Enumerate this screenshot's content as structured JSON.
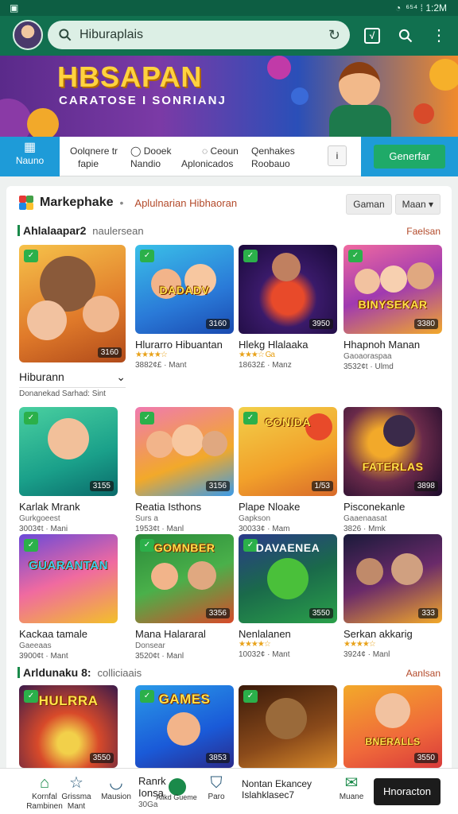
{
  "status": {
    "left_icon": "sim-icon",
    "right_text": "⁶⁵⁴ ⁞ 1:2M"
  },
  "appbar": {
    "search_placeholder": "Hiburaplais",
    "icons": [
      "avatar",
      "search-icon",
      "refresh-icon",
      "tv-icon",
      "search-icon",
      "more-vert-icon"
    ]
  },
  "banner": {
    "title": "HBSAPAN",
    "subtitle": "CARATOSE I SONRIANJ"
  },
  "tabs": {
    "active": "Nauno",
    "items": [
      {
        "label": "Oolqnere tr",
        "sub": "fapie"
      },
      {
        "label": "Dooek",
        "sub": "Nandio"
      },
      {
        "label": "Ceoun",
        "sub": "Aplonicados"
      },
      {
        "label": "Qenhakes",
        "sub": "Roobauo"
      }
    ],
    "mini": "i",
    "cta": "Generfar"
  },
  "market": {
    "name": "Markephake",
    "sub": "Aplulnarian Hibhaoran",
    "filters": [
      "Gaman",
      "Maan ▾"
    ]
  },
  "section1": {
    "title": "Ahlalaapar2",
    "desc": "naulersean",
    "more": "Faelsan",
    "featured": {
      "title": "Hiburann",
      "sub": "Donanekad Sarhad: Sint"
    },
    "row1": [
      {
        "title": "Hlurarro Hibuantan",
        "sub": "",
        "stars": "★★★★☆",
        "meta": "3882¢£ · Mant",
        "rate": "3160",
        "cap": "DADADV"
      },
      {
        "title": "Hlekg Hlalaaka",
        "sub": "",
        "stars": "★★★☆ Ga",
        "meta": "18632£ · Manz",
        "rate": "3950",
        "cap": ""
      },
      {
        "title": "Hhapnoh Manan",
        "sub": "Gaoaoraspaa",
        "stars": "",
        "meta": "3532¢t · Ulmd",
        "rate": "3380",
        "cap": "BINYSEKAR"
      }
    ],
    "row2": [
      {
        "title": "Karlak Mrank",
        "sub": "Gurkgoeest",
        "stars": "",
        "meta": "3003¢t · Mani",
        "rate": "3155",
        "cap": ""
      },
      {
        "title": "Reatia Isthons",
        "sub": "Surs a",
        "stars": "",
        "meta": "1953¢t · Manl",
        "rate": "3156",
        "cap": ""
      },
      {
        "title": "Plape Nloake",
        "sub": "Gapkson",
        "stars": "",
        "meta": "30033¢ · Mam",
        "rate": "1/53",
        "cap": "CONIDA"
      },
      {
        "title": "Pisconekanle",
        "sub": "Gaaenaasat",
        "stars": "",
        "meta": "3826 · Mmk",
        "rate": "3898",
        "cap": "FATERLAS"
      }
    ],
    "row3": [
      {
        "title": "Kackaa tamale",
        "sub": "Gaeeaas",
        "stars": "",
        "meta": "3900¢t · Mant",
        "rate": "",
        "cap": "GUARANTAN"
      },
      {
        "title": "Mana Halararal",
        "sub": "Donsear",
        "stars": "",
        "meta": "3520¢t · Manl",
        "rate": "3356",
        "cap": "GOMNBER"
      },
      {
        "title": "Nenlalanen",
        "sub": "",
        "stars": "★★★★☆",
        "meta": "10032¢ · Mant",
        "rate": "3550",
        "cap": "DAVAENEA"
      },
      {
        "title": "Serkan akkarig",
        "sub": "",
        "stars": "★★★★☆",
        "meta": "3924¢ · Manl",
        "rate": "333",
        "cap": ""
      }
    ]
  },
  "section2": {
    "title": "Arldunaku 8:",
    "desc": "colliciaais",
    "more": "Aanlsan",
    "row": [
      {
        "cap": "HULRRA",
        "rate": "3550"
      },
      {
        "cap": "GAMES",
        "rate": "3853"
      },
      {
        "cap": "",
        "rate": ""
      },
      {
        "cap": "BNERALLS",
        "rate": "3550"
      }
    ]
  },
  "bottom": {
    "nav": [
      {
        "icon": "home-icon",
        "label": "Kornfal Rambinen"
      },
      {
        "icon": "star-icon",
        "label": "Grissma Mant"
      },
      {
        "icon": "chat-icon",
        "label": "Mausion"
      }
    ],
    "mid": {
      "title": "Ranrk",
      "sub1": "Ionsa",
      "sub2": "30Ga",
      "dot_label": "Alikd Gueme"
    },
    "nav2": [
      {
        "icon": "person-icon",
        "label": "Paro"
      }
    ],
    "mid2": {
      "line1": "Nontan Ekancey",
      "line2": "Islahklasec7"
    },
    "nav3": [
      {
        "icon": "badge-icon",
        "label": "Muane"
      }
    ],
    "cta": "Hnoracton"
  },
  "colors": {
    "primary": "#11704f",
    "accent": "#1e9bd8",
    "cta": "#1faa68"
  }
}
